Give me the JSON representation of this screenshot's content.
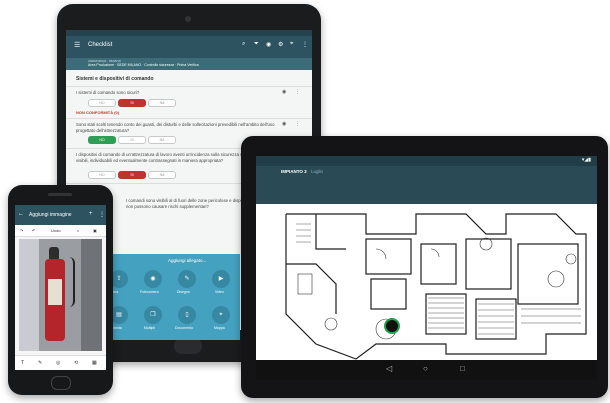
{
  "back_tablet": {
    "title": "Checklist",
    "context_line1": "ANDROIDS/2 · 06/05/19",
    "context_line2": "Area Produzione · SEDE MILANO · Controllo sicurezza · Prima Verifica",
    "section_title": "Sistemi e dispositivi di comando",
    "question1": "I sistemi di comando sono sicuri?",
    "nonconformity_label": "NON CONFORMITÀ (0)",
    "question2": "Sono stati scelti tenendo conto dei guasti, dei disturbi e delle sollecitazioni prevedibili nell'ambito dell'uso progettato dell'attrezzatura?",
    "question3": "I dispositivi di comando di un'attrezzatura di lavoro aventi un'incidenza sulla sicurezza sono chiaramente visibili, individuabili ed eventualmente contrassegnati in maniera appropriata?",
    "question4": "I comandi sono visibili al di fuori delle zone pericolose e dispositivi di manovra non possono causare rischi supplementari?",
    "option_no": "NO",
    "option_si": "SI",
    "option_na": "NA",
    "overlay_title": "Aggiungi allegato...",
    "attach_options": [
      "Carica",
      "Fotocamera",
      "Disegno",
      "Video",
      "Scheda",
      "Multipli",
      "Documento",
      "Mappa"
    ]
  },
  "right_tablet": {
    "title": "IMPIANTO 3",
    "subtitle": "Luglio"
  },
  "phone": {
    "title": "Aggiungi immagine",
    "undo_label": "Undo",
    "bottom_tools": [
      "T",
      "✎",
      "◎",
      "⟲",
      "▦"
    ]
  },
  "colors": {
    "app_bar": "#2d5360",
    "accent_red": "#c0332a",
    "accent_green": "#2e9e54",
    "overlay_blue": "#44a1bf",
    "marker_green": "#1fa24a"
  }
}
